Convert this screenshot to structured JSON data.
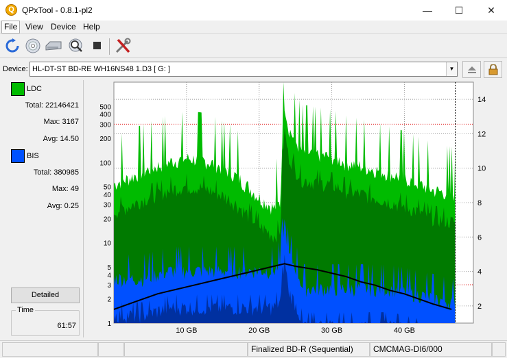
{
  "window": {
    "title": "QPxTool - 0.8.1-pl2",
    "controls": {
      "minimize": "—",
      "maximize": "☐",
      "close": "✕"
    }
  },
  "menu": {
    "items": [
      "File",
      "View",
      "Device",
      "Help"
    ]
  },
  "toolbar": {
    "buttons": [
      "refresh-icon",
      "disc-icon",
      "drive-icon",
      "scan-icon",
      "stop-icon",
      "tools-icon"
    ]
  },
  "device": {
    "label": "Device:",
    "selected": "HL-DT-ST BD-RE  WH16NS48  1.D3 [ G: ]",
    "eject_icon": "eject-icon",
    "lock_icon": "lock-icon"
  },
  "stats": {
    "ldc": {
      "name": "LDC",
      "color": "#00bb00",
      "total_label": "Total:",
      "total": "22146421",
      "max_label": "Max:",
      "max": "3167",
      "avg_label": "Avg:",
      "avg": "14.50"
    },
    "bis": {
      "name": "BIS",
      "color": "#0050ff",
      "total_label": "Total:",
      "total": "380985",
      "max_label": "Max:",
      "max": "49",
      "avg_label": "Avg:",
      "avg": "0.25"
    }
  },
  "detailed_button": "Detailed",
  "time": {
    "label": "Time",
    "value": "61:57"
  },
  "status": {
    "cells": [
      "",
      "",
      "",
      "Finalized BD-R (Sequential)",
      "CMCMAG-DI6/000",
      ""
    ]
  },
  "chart_data": {
    "type": "area",
    "x_unit": "GB",
    "x_range": [
      0,
      47
    ],
    "x_ticks": [
      "10 GB",
      "20 GB",
      "30 GB",
      "40 GB"
    ],
    "x_tick_values": [
      10,
      20,
      30,
      40
    ],
    "y_left_scale": "log",
    "y_left_range": [
      1,
      1000
    ],
    "y_left_ticks": [
      "1",
      "2",
      "3",
      "4",
      "5",
      "10",
      "20",
      "30",
      "40",
      "50",
      "100",
      "200",
      "300",
      "400",
      "500"
    ],
    "y_left_tick_values": [
      1,
      2,
      3,
      4,
      5,
      10,
      20,
      30,
      40,
      50,
      100,
      200,
      300,
      400,
      500
    ],
    "y_right_range": [
      1,
      15
    ],
    "y_right_ticks": [
      "2",
      "4",
      "6",
      "8",
      "10",
      "12",
      "14"
    ],
    "y_right_tick_values": [
      2,
      4,
      6,
      8,
      10,
      12,
      14
    ],
    "grid": true,
    "red_reference_lines_left": [
      300,
      3
    ],
    "colors": {
      "ldc": "#00bb00",
      "ldc_dark": "#007a00",
      "bis": "#0050ff",
      "bis_dark": "#0030a0",
      "speed": "#000000"
    },
    "series": [
      {
        "name": "LDC",
        "x": [
          0,
          2,
          4,
          6,
          8,
          10,
          12,
          14,
          16,
          18,
          20,
          22,
          23,
          23.5,
          24,
          25,
          26,
          28,
          30,
          32,
          34,
          36,
          38,
          40,
          42,
          44,
          46.5
        ],
        "values": [
          60,
          70,
          85,
          100,
          115,
          125,
          120,
          105,
          85,
          60,
          40,
          30,
          35,
          600,
          300,
          200,
          150,
          140,
          130,
          110,
          100,
          90,
          80,
          70,
          60,
          50,
          45
        ]
      },
      {
        "name": "BIS",
        "x": [
          0,
          4,
          8,
          12,
          16,
          20,
          22,
          23,
          23.5,
          24,
          26,
          30,
          34,
          38,
          42,
          46.5
        ],
        "values": [
          4,
          4,
          5,
          5,
          5,
          5,
          5,
          6,
          20,
          8,
          3,
          3,
          3,
          3,
          2.5,
          2
        ]
      },
      {
        "x": [
          0,
          2,
          4,
          6,
          8,
          10,
          12,
          14,
          16,
          18,
          20,
          22,
          23.5,
          25,
          28,
          30,
          32,
          34,
          36,
          38,
          40,
          42,
          44,
          46.5
        ],
        "values": [
          1.8,
          2.1,
          2.4,
          2.7,
          2.9,
          3.1,
          3.3,
          3.5,
          3.7,
          3.9,
          4.1,
          4.3,
          4.45,
          4.3,
          4.1,
          3.9,
          3.7,
          3.4,
          3.2,
          2.9,
          2.7,
          2.4,
          2.1,
          1.8
        ]
      }
    ]
  }
}
